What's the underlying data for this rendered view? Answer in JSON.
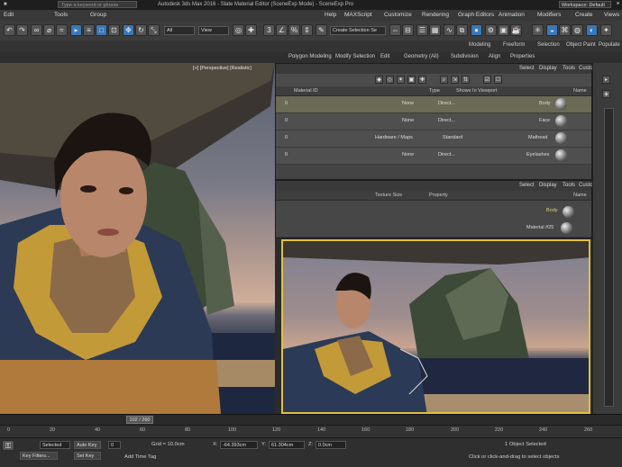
{
  "title_bar": {
    "search_placeholder": "Type a keyword or phrase",
    "title": "Autodesk 3ds Max 2016 - Slate Material Editor (SceneExp Mode) - SceneExp Pro",
    "workspace": "Workspace: Default",
    "window_controls": [
      "—",
      "□",
      "×"
    ]
  },
  "menu": [
    "Edit",
    "Tools",
    "Group",
    "Views",
    "Create",
    "Modifiers",
    "Animation",
    "Graph Editors",
    "Rendering",
    "Customize",
    "MAXScript",
    "Help"
  ],
  "toolbar": {
    "selection_filter": "All",
    "view_dropdown": "View",
    "named_selection": "Create Selection Se"
  },
  "ribbon": {
    "tabs": [
      "Modeling",
      "Freeform",
      "Selection",
      "Object Paint",
      "Populate"
    ],
    "subtabs": [
      "Polygon Modeling",
      "Modify Selection",
      "Edit",
      "Geometry (All)",
      "Subdivision",
      "Align",
      "Properties"
    ]
  },
  "viewport_main": {
    "label": "[+] [Perspective] [Realistic]"
  },
  "scene_explorer": {
    "menu": [
      "Select",
      "Display",
      "Tools",
      "Customize"
    ],
    "columns": [
      "Name",
      "Shows In Viewport",
      "Type",
      "Material ID"
    ],
    "rows": [
      {
        "name": "Body",
        "shows": "Direct...",
        "type": "None",
        "id": "0",
        "selected": true
      },
      {
        "name": "Face",
        "shows": "Direct...",
        "type": "None",
        "id": "0",
        "selected": false
      },
      {
        "name": "Mathead",
        "shows": "Standard",
        "type": "Hardware / Maps",
        "id": "0",
        "selected": false
      },
      {
        "name": "Eyelashes",
        "shows": "Direct...",
        "type": "None",
        "id": "0",
        "selected": false
      }
    ]
  },
  "material_panel": {
    "menu": [
      "Select",
      "Display",
      "Tools",
      "Customize"
    ],
    "columns": [
      "Name",
      "Property",
      "Texture Size"
    ],
    "rows": [
      {
        "name": "Body",
        "sub": "Material #25"
      }
    ]
  },
  "timeline": {
    "slider": "102 / 260",
    "ticks": [
      "0",
      "20",
      "40",
      "60",
      "80",
      "100",
      "120",
      "140",
      "160",
      "180",
      "200",
      "220",
      "240",
      "260"
    ]
  },
  "status": {
    "selection": "1 Object Selected",
    "prompt": "Click or click-and-drag to select objects",
    "x_label": "X:",
    "x_value": "-64.393cm",
    "y_label": "Y:",
    "y_value": "61.304cm",
    "z_label": "Z:",
    "z_value": "0.0cm",
    "grid": "Grid = 10.0cm",
    "auto_key": "Auto Key",
    "set_key": "Set Key",
    "selected_dropdown": "Selected",
    "key_filters": "Key Filters...",
    "add_time_tag": "Add Time Tag",
    "frame": "0"
  }
}
